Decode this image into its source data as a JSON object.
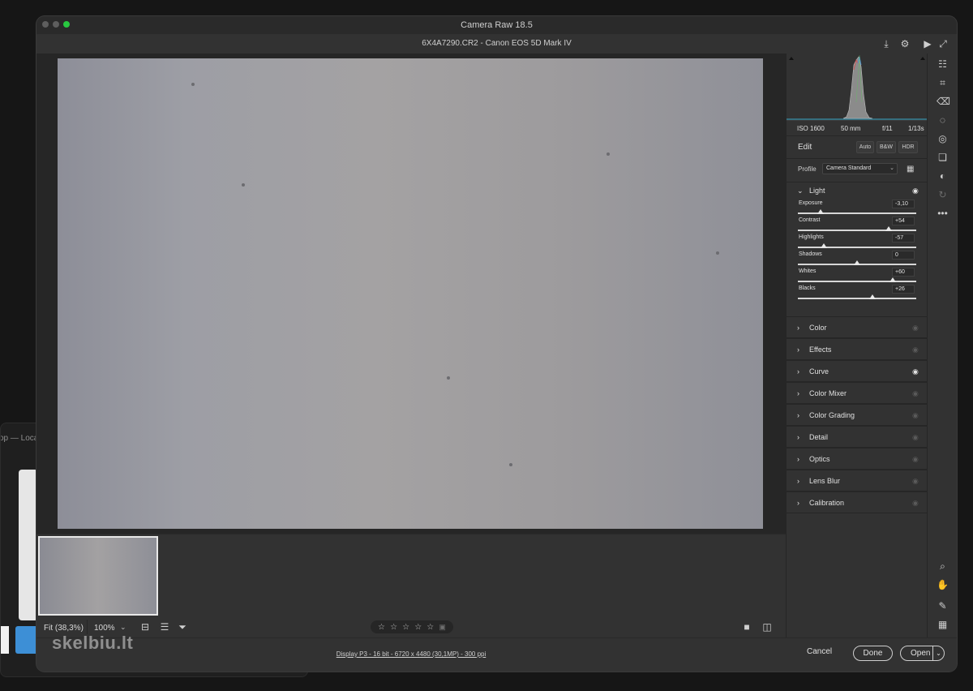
{
  "background_window": {
    "title": "op — Loca"
  },
  "watermark": "skelbiu.lt",
  "window": {
    "title": "Camera Raw 18.5",
    "file": "6X4A7290.CR2  -  Canon EOS 5D Mark IV"
  },
  "exif": {
    "iso": "ISO 1600",
    "focal": "50 mm",
    "aperture": "f/11",
    "shutter": "1/13s"
  },
  "edit": {
    "title": "Edit",
    "auto": "Auto",
    "bw": "B&W",
    "hdr": "HDR"
  },
  "profile": {
    "label": "Profile",
    "value": "Camera Standard"
  },
  "light": {
    "label": "Light",
    "sliders": [
      {
        "label": "Exposure",
        "value": "-3,10",
        "pos": 0.19
      },
      {
        "label": "Contrast",
        "value": "+54",
        "pos": 0.77
      },
      {
        "label": "Highlights",
        "value": "-57",
        "pos": 0.22
      },
      {
        "label": "Shadows",
        "value": "0",
        "pos": 0.5
      },
      {
        "label": "Whites",
        "value": "+60",
        "pos": 0.8
      },
      {
        "label": "Blacks",
        "value": "+26",
        "pos": 0.63
      }
    ]
  },
  "sections": [
    {
      "label": "Color",
      "eye_active": false
    },
    {
      "label": "Effects",
      "eye_active": false
    },
    {
      "label": "Curve",
      "eye_active": true
    },
    {
      "label": "Color Mixer",
      "eye_active": false
    },
    {
      "label": "Color Grading",
      "eye_active": false
    },
    {
      "label": "Detail",
      "eye_active": false
    },
    {
      "label": "Optics",
      "eye_active": false
    },
    {
      "label": "Lens Blur",
      "eye_active": false
    },
    {
      "label": "Calibration",
      "eye_active": false
    }
  ],
  "zoom": {
    "fit": "Fit (38,3%)",
    "level": "100%"
  },
  "rating": 0,
  "footer": {
    "info": "Display P3 - 16 bit - 6720 x 4480 (30,1MP) - 300 ppi",
    "cancel": "Cancel",
    "done": "Done",
    "open": "Open"
  },
  "colors": {
    "panel": "#323232",
    "canvas": "#262626",
    "accent_eye": "#e0e0e0"
  }
}
